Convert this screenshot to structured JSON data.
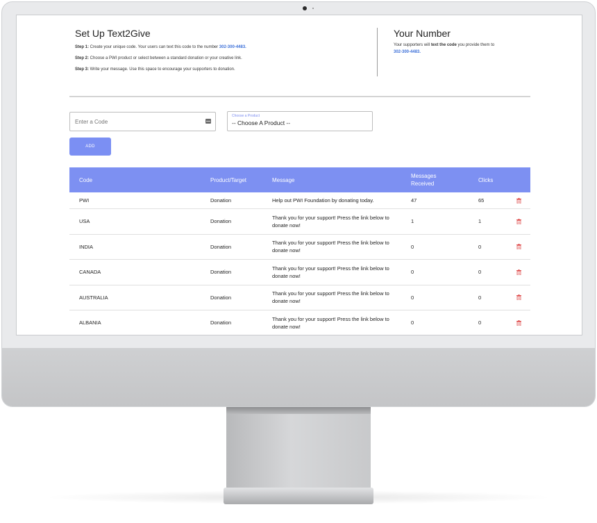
{
  "setup": {
    "title": "Set Up Text2Give",
    "step1_label": "Step 1:",
    "step1_text": " Create your unique code. Your users can text this code to the number ",
    "step1_phone": "302-300-4483.",
    "step2_label": "Step 2:",
    "step2_text": " Choose a PWI product or select between a standard donation or your creative link.",
    "step3_label": "Step 3:",
    "step3_text": " Write your message. Use this space to encourage your supporters to donation."
  },
  "number": {
    "title": "Your Number",
    "desc_a": "Your supporters will ",
    "desc_bold": "text the code",
    "desc_b": " you provide them to",
    "phone": "302-300-4483."
  },
  "form": {
    "code_placeholder": "Enter a Code",
    "product_label": "Choose a Product",
    "product_value": "-- Choose A Product --",
    "add_label": "ADD"
  },
  "table": {
    "headers": {
      "code": "Code",
      "product": "Product/Target",
      "message": "Message",
      "received_line1": "Messages",
      "received_line2": "Received",
      "clicks": "Clicks"
    },
    "rows": [
      {
        "code": "PWI",
        "product": "Donation",
        "message": "Help out PWI Foundation by donating today.",
        "received": "47",
        "clicks": "65"
      },
      {
        "code": "USA",
        "product": "Donation",
        "message": "Thank you for your support! Press the link below to donate now!",
        "received": "1",
        "clicks": "1"
      },
      {
        "code": "INDIA",
        "product": "Donation",
        "message": "Thank you for your support! Press the link below to donate now!",
        "received": "0",
        "clicks": "0"
      },
      {
        "code": "CANADA",
        "product": "Donation",
        "message": "Thank you for your support! Press the link below to donate now!",
        "received": "0",
        "clicks": "0"
      },
      {
        "code": "AUSTRALIA",
        "product": "Donation",
        "message": "Thank you for your support! Press the link below to donate now!",
        "received": "0",
        "clicks": "0"
      },
      {
        "code": "ALBANIA",
        "product": "Donation",
        "message": "Thank you for your support! Press the link below to donate now!",
        "received": "0",
        "clicks": "0"
      }
    ]
  },
  "icons": {
    "delete": "trash-icon",
    "code_field": "keyboard-icon"
  },
  "colors": {
    "accent": "#7d90f2",
    "link": "#3b6fd8",
    "delete": "#e05252"
  }
}
